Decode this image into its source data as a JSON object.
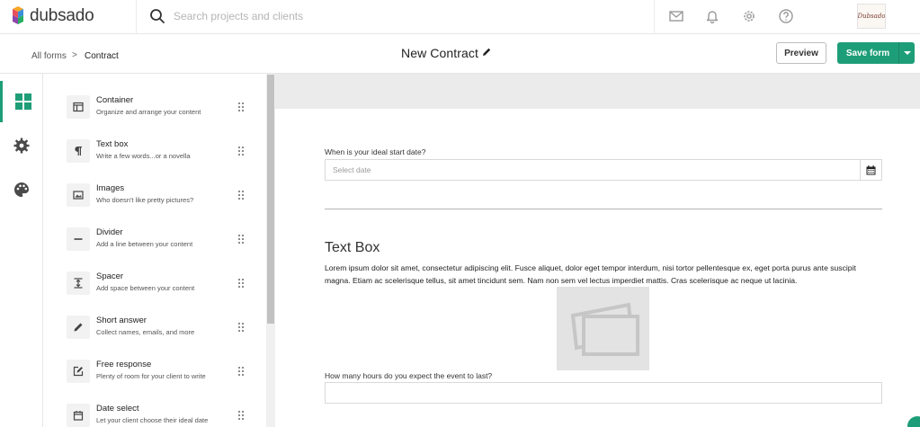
{
  "app": {
    "logo_text": "dubsado"
  },
  "search": {
    "placeholder": "Search projects and clients"
  },
  "topbar": {
    "icons": [
      "mail-icon",
      "bell-icon",
      "gear-icon",
      "help-icon"
    ],
    "avatar_text": "Dubsado"
  },
  "breadcrumb": {
    "root": "All forms",
    "separator": ">",
    "current": "Contract"
  },
  "form": {
    "title": "New Contract"
  },
  "actions": {
    "preview_label": "Preview",
    "save_label": "Save form"
  },
  "rail": {
    "items": [
      "elements-grid-icon",
      "settings-gear-icon",
      "theme-palette-icon"
    ]
  },
  "elements": [
    {
      "title": "Container",
      "desc": "Organize and arrange your content",
      "icon": "container-icon"
    },
    {
      "title": "Text box",
      "desc": "Write a few words...or a novella",
      "icon": "paragraph-icon"
    },
    {
      "title": "Images",
      "desc": "Who doesn't like pretty pictures?",
      "icon": "image-icon"
    },
    {
      "title": "Divider",
      "desc": "Add a line between your content",
      "icon": "divider-icon"
    },
    {
      "title": "Spacer",
      "desc": "Add space between your content",
      "icon": "spacer-icon"
    },
    {
      "title": "Short answer",
      "desc": "Collect names, emails, and more",
      "icon": "pencil-icon"
    },
    {
      "title": "Free response",
      "desc": "Plenty of room for your client to write",
      "icon": "edit-square-icon"
    },
    {
      "title": "Date select",
      "desc": "Let your client choose their ideal date",
      "icon": "calendar-icon"
    }
  ],
  "canvas": {
    "date_question": "When is your ideal start date?",
    "date_placeholder": "Select date",
    "textbox_heading": "Text Box",
    "textbox_body": "Lorem ipsum dolor sit amet, consectetur adipiscing elit. Fusce aliquet, dolor eget tempor interdum, nisi tortor pellentesque ex, eget porta purus ante suscipit magna. Etiam ac scelerisque tellus, sit amet tincidunt sem. Nam non sem vel lectus imperdiet mattis. Cras scelerisque ac neque ut lacinia.",
    "hours_question": "How many hours do you expect the event to last?"
  },
  "colors": {
    "accent": "#1e9e78",
    "canvas_band": "#ebebeb"
  }
}
